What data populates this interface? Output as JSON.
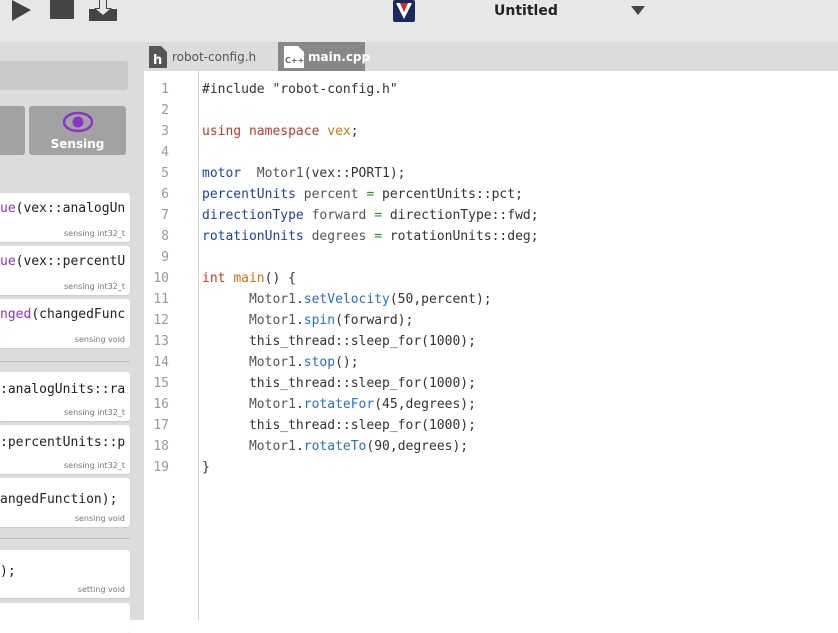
{
  "window": {
    "title": "Untitled",
    "icons": [
      "play-icon",
      "stop-icon",
      "download-icon",
      "vex-logo-icon",
      "caret-down-icon"
    ]
  },
  "sidebar": {
    "categories": [
      {
        "label": "Sensing",
        "icon": "eye-icon",
        "color": "#8a35c8"
      }
    ],
    "blocks": [
      {
        "pre": "",
        "fn": "ue",
        "post": "(vex::analogUn",
        "tag": "sensing int32_t"
      },
      {
        "pre": "",
        "fn": "ue",
        "post": "(vex::percentU",
        "tag": "sensing int32_t"
      },
      {
        "pre": "",
        "fn": "nged",
        "post": "(changedFunc",
        "tag": "sensing void"
      },
      {
        "pre": ":analogUnits::ra",
        "fn": "",
        "post": "",
        "tag": "sensing int32_t"
      },
      {
        "pre": ":percentUnits::p",
        "fn": "",
        "post": "",
        "tag": "sensing int32_t"
      },
      {
        "pre": "angedFunction);",
        "fn": "",
        "post": "",
        "tag": "sensing void"
      },
      {
        "pre": ");",
        "fn": "",
        "post": "",
        "tag": "setting void"
      }
    ]
  },
  "tabs": [
    {
      "label": "robot-config.h",
      "icon": "h-file-icon",
      "active": false
    },
    {
      "label": "main.cpp",
      "icon": "cpp-file-icon",
      "active": true
    }
  ],
  "editor": {
    "line_numbers": [
      "1",
      "2",
      "3",
      "4",
      "5",
      "6",
      "7",
      "8",
      "9",
      "10",
      "11",
      "12",
      "13",
      "14",
      "15",
      "16",
      "17",
      "18",
      "19"
    ],
    "lines": [
      [
        {
          "t": "#include \"robot-config.h\"",
          "c": "str"
        }
      ],
      [],
      [
        {
          "t": "using",
          "c": "kw"
        },
        {
          "t": " "
        },
        {
          "t": "namespace",
          "c": "kw"
        },
        {
          "t": " "
        },
        {
          "t": "vex",
          "c": "ns"
        },
        {
          "t": ";"
        }
      ],
      [],
      [
        {
          "t": "motor",
          "c": "ty"
        },
        {
          "t": "  "
        },
        {
          "t": "Motor1",
          "c": "var"
        },
        {
          "t": "(vex::PORT1);"
        }
      ],
      [
        {
          "t": "percentUnits",
          "c": "ty"
        },
        {
          "t": " "
        },
        {
          "t": "percent",
          "c": "var"
        },
        {
          "t": " "
        },
        {
          "t": "=",
          "c": "op"
        },
        {
          "t": " percentUnits::pct;"
        }
      ],
      [
        {
          "t": "directionType",
          "c": "ty"
        },
        {
          "t": " "
        },
        {
          "t": "forward",
          "c": "var"
        },
        {
          "t": " "
        },
        {
          "t": "=",
          "c": "op"
        },
        {
          "t": " directionType::fwd;"
        }
      ],
      [
        {
          "t": "rotationUnits",
          "c": "ty"
        },
        {
          "t": " "
        },
        {
          "t": "degrees",
          "c": "var"
        },
        {
          "t": " "
        },
        {
          "t": "=",
          "c": "op"
        },
        {
          "t": " rotationUnits::deg;"
        }
      ],
      [],
      [
        {
          "t": "int",
          "c": "kw"
        },
        {
          "t": " "
        },
        {
          "t": "main",
          "c": "ns"
        },
        {
          "t": "() {"
        }
      ],
      [
        {
          "t": "      "
        },
        {
          "t": "Motor1",
          "c": "var"
        },
        {
          "t": "."
        },
        {
          "t": "setVelocity",
          "c": "mth"
        },
        {
          "t": "(50,percent);"
        }
      ],
      [
        {
          "t": "      "
        },
        {
          "t": "Motor1",
          "c": "var"
        },
        {
          "t": "."
        },
        {
          "t": "spin",
          "c": "mth"
        },
        {
          "t": "(forward);"
        }
      ],
      [
        {
          "t": "      this_thread::sleep_for(1000);"
        }
      ],
      [
        {
          "t": "      "
        },
        {
          "t": "Motor1",
          "c": "var"
        },
        {
          "t": "."
        },
        {
          "t": "stop",
          "c": "mth"
        },
        {
          "t": "();"
        }
      ],
      [
        {
          "t": "      this_thread::sleep_for(1000);"
        }
      ],
      [
        {
          "t": "      "
        },
        {
          "t": "Motor1",
          "c": "var"
        },
        {
          "t": "."
        },
        {
          "t": "rotateFor",
          "c": "mth"
        },
        {
          "t": "(45,degrees);"
        }
      ],
      [
        {
          "t": "      this_thread::sleep_for(1000);"
        }
      ],
      [
        {
          "t": "      "
        },
        {
          "t": "Motor1",
          "c": "var"
        },
        {
          "t": "."
        },
        {
          "t": "rotateTo",
          "c": "mth"
        },
        {
          "t": "(90,degrees);"
        }
      ],
      [
        {
          "t": "}"
        }
      ]
    ]
  }
}
